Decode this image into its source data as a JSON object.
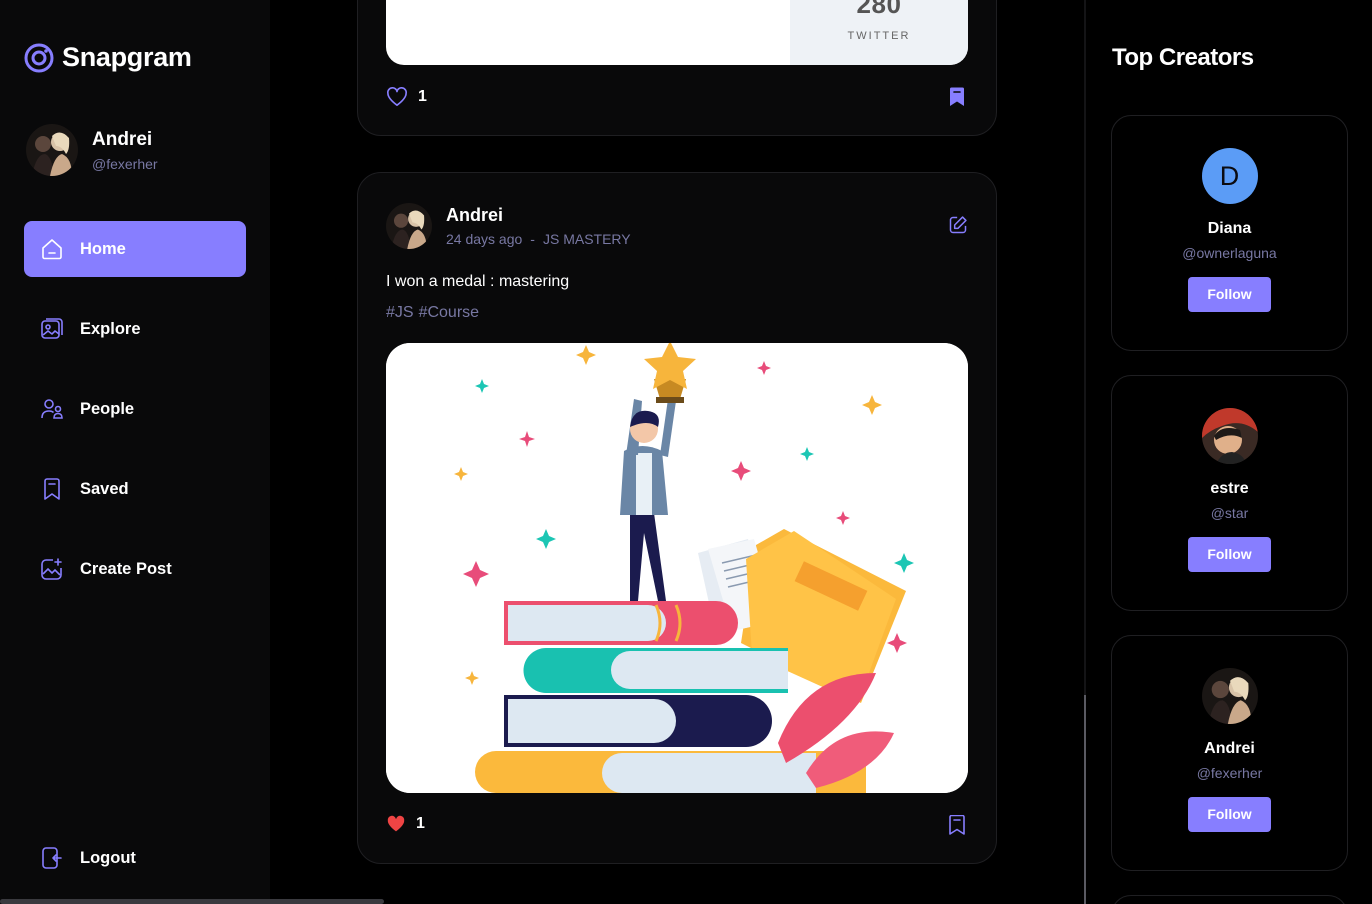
{
  "app": {
    "name": "Snapgram"
  },
  "user": {
    "name": "Andrei",
    "handle": "@fexerher"
  },
  "nav": {
    "items": [
      {
        "label": "Home",
        "icon": "home-icon",
        "active": true
      },
      {
        "label": "Explore",
        "icon": "gallery-icon",
        "active": false
      },
      {
        "label": "People",
        "icon": "people-icon",
        "active": false
      },
      {
        "label": "Saved",
        "icon": "bookmark-icon",
        "active": false
      },
      {
        "label": "Create Post",
        "icon": "create-post-icon",
        "active": false
      }
    ],
    "logout_label": "Logout"
  },
  "feed": {
    "previous_post": {
      "embed_count": "280",
      "embed_label": "TWITTER",
      "likes": "1"
    },
    "post": {
      "author": "Andrei",
      "time": "24 days ago",
      "separator": "-",
      "location": "JS MASTERY",
      "caption": "I won a medal : mastering",
      "tags": [
        "#JS",
        "#Course"
      ],
      "likes": "1"
    }
  },
  "right_sidebar": {
    "title": "Top Creators",
    "creators": [
      {
        "name": "Diana",
        "handle": "@ownerlaguna",
        "initial": "D",
        "follow_label": "Follow"
      },
      {
        "name": "estre",
        "handle": "@star",
        "follow_label": "Follow"
      },
      {
        "name": "Andrei",
        "handle": "@fexerher",
        "follow_label": "Follow"
      }
    ]
  },
  "colors": {
    "accent": "#877eff",
    "background": "#000000",
    "surface": "#09090a",
    "muted_text": "#7878a3",
    "like_red": "#ef4444"
  }
}
